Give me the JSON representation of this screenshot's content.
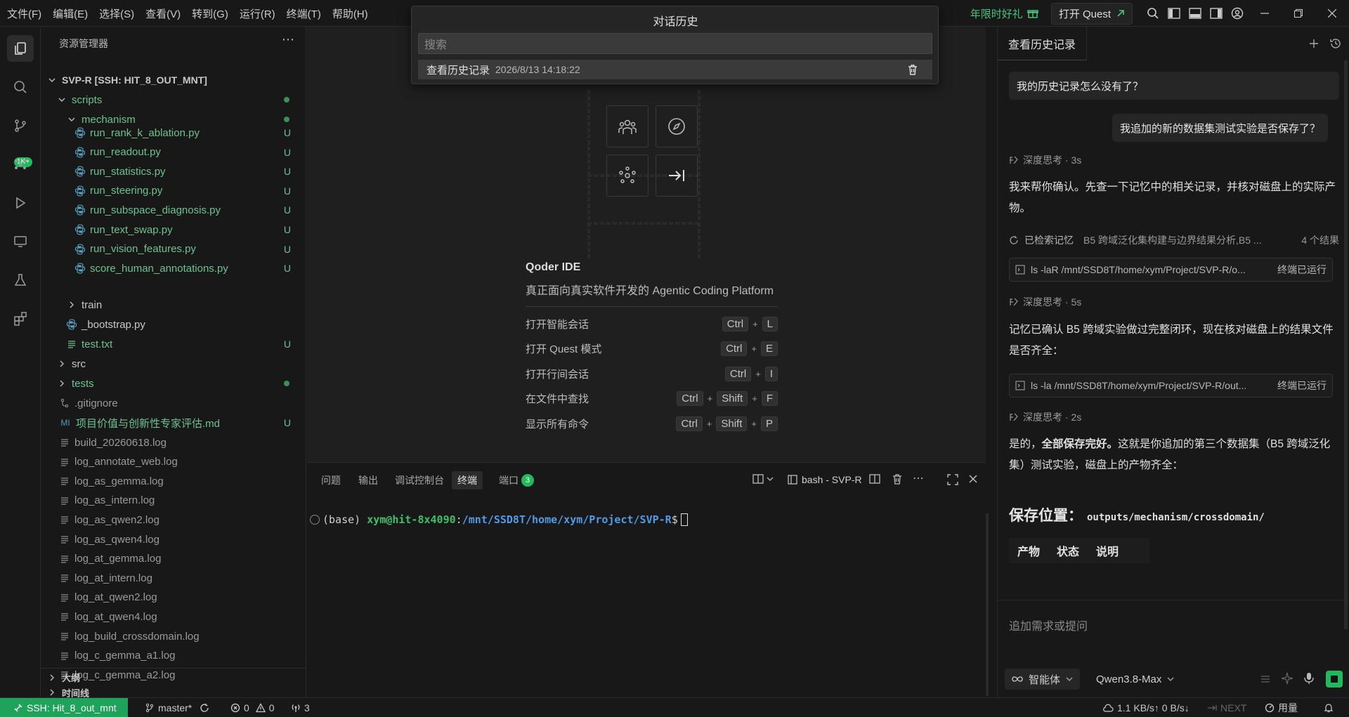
{
  "menu": [
    "文件(F)",
    "编辑(E)",
    "选择(S)",
    "查看(V)",
    "转到(G)",
    "运行(R)",
    "终端(T)",
    "帮助(H)"
  ],
  "titlebar": {
    "promo": "年限时好礼",
    "quest_button": "打开 Quest"
  },
  "history_popup": {
    "title": "对话历史",
    "search_placeholder": "搜索",
    "item_title": "查看历史记录",
    "item_time": "2026/8/13 14:18:22"
  },
  "activity": {
    "badge": "1K+"
  },
  "explorer": {
    "header": "资源管理器",
    "root": "SVP-R [SSH: HIT_8_OUT_MNT]",
    "folders": {
      "scripts": "scripts",
      "mechanism": "mechanism",
      "train": "train",
      "src": "src",
      "tests": "tests"
    },
    "mechanism_files": [
      {
        "name": "run_rank_k_ablation.py",
        "status": "U"
      },
      {
        "name": "run_readout.py",
        "status": "U"
      },
      {
        "name": "run_statistics.py",
        "status": "U"
      },
      {
        "name": "run_steering.py",
        "status": "U"
      },
      {
        "name": "run_subspace_diagnosis.py",
        "status": "U"
      },
      {
        "name": "run_text_swap.py",
        "status": "U"
      },
      {
        "name": "run_vision_features.py",
        "status": "U"
      },
      {
        "name": "score_human_annotations.py",
        "status": "U"
      }
    ],
    "bootstrap": "_bootstrap.py",
    "test_txt": {
      "name": "test.txt",
      "status": "U"
    },
    "gitignore": ".gitignore",
    "md_file": {
      "icon": "MI",
      "name": "项目价值与创新性专家评估.md",
      "status": "U"
    },
    "logs": [
      "build_20260618.log",
      "log_annotate_web.log",
      "log_as_gemma.log",
      "log_as_intern.log",
      "log_as_qwen2.log",
      "log_as_qwen4.log",
      "log_at_gemma.log",
      "log_at_intern.log",
      "log_at_qwen2.log",
      "log_at_qwen4.log",
      "log_build_crossdomain.log",
      "log_c_gemma_a1.log",
      "log_c_gemma_a2.log"
    ],
    "outline": "大纲",
    "timeline": "时间线"
  },
  "welcome": {
    "title": "Qoder IDE",
    "subtitle": "真正面向真实软件开发的 Agentic Coding Platform",
    "shortcuts": [
      {
        "label": "打开智能会话",
        "keys": [
          "Ctrl",
          "L"
        ]
      },
      {
        "label": "打开 Quest 模式",
        "keys": [
          "Ctrl",
          "E"
        ]
      },
      {
        "label": "打开行间会话",
        "keys": [
          "Ctrl",
          "I"
        ]
      },
      {
        "label": "在文件中查找",
        "keys": [
          "Ctrl",
          "Shift",
          "F"
        ]
      },
      {
        "label": "显示所有命令",
        "keys": [
          "Ctrl",
          "Shift",
          "P"
        ]
      }
    ]
  },
  "panel": {
    "tabs": [
      "问题",
      "输出",
      "调试控制台",
      "终端",
      "端口"
    ],
    "ports_badge": "3",
    "terminal_name": "bash - SVP-R",
    "prompt_env": "(base)",
    "prompt_user": "xym@hit-8x4090",
    "prompt_colon": ":",
    "prompt_path": "/mnt/SSD8T/home/xym/Project/SVP-R",
    "prompt_dollar": "$"
  },
  "chat": {
    "tab": "查看历史记录",
    "user_msg_1": "我的历史记录怎么没有了？",
    "user_msg_2": "我追加的新的数据集测试实验是否保存了？",
    "think_1": "深度思考 · 3s",
    "para_1": "我来帮你确认。先查一下记忆中的相关记录，并核对磁盘上的实际产物。",
    "memory_label": "已检索记忆",
    "memory_text": "B5 跨域泛化集构建与边界结果分析,B5 ...",
    "memory_count": "4 个结果",
    "tool_1_cmd": "ls -laR /mnt/SSD8T/home/xym/Project/SVP-R/o...",
    "tool_1_status": "终端已运行",
    "think_2": "深度思考 · 5s",
    "para_2": "记忆已确认 B5 跨域实验做过完整闭环，现在核对磁盘上的结果文件是否齐全：",
    "tool_2_cmd": "ls -la /mnt/SSD8T/home/xym/Project/SVP-R/out...",
    "tool_2_status": "终端已运行",
    "think_3": "深度思考 · 2s",
    "para_3_pre": "是的，",
    "para_3_bold": "全部保存完好。",
    "para_3_post": "这就是你追加的第三个数据集（B5 跨域泛化集）测试实验，磁盘上的产物齐全：",
    "save_heading": "保存位置：",
    "save_path": "outputs/mechanism/crossdomain/",
    "table_headers": [
      "产物",
      "状态",
      "说明"
    ],
    "input_placeholder": "追加需求或提问",
    "agent_mode": "智能体",
    "model": "Qwen3.8-Max"
  },
  "status": {
    "ssh": "SSH: Hit_8_out_mnt",
    "branch": "master*",
    "errors": "0",
    "warnings": "0",
    "ports": "3",
    "network": "1.1 KB/s↑ 0 B/s↓",
    "next": "NEXT",
    "usage": "用量"
  }
}
